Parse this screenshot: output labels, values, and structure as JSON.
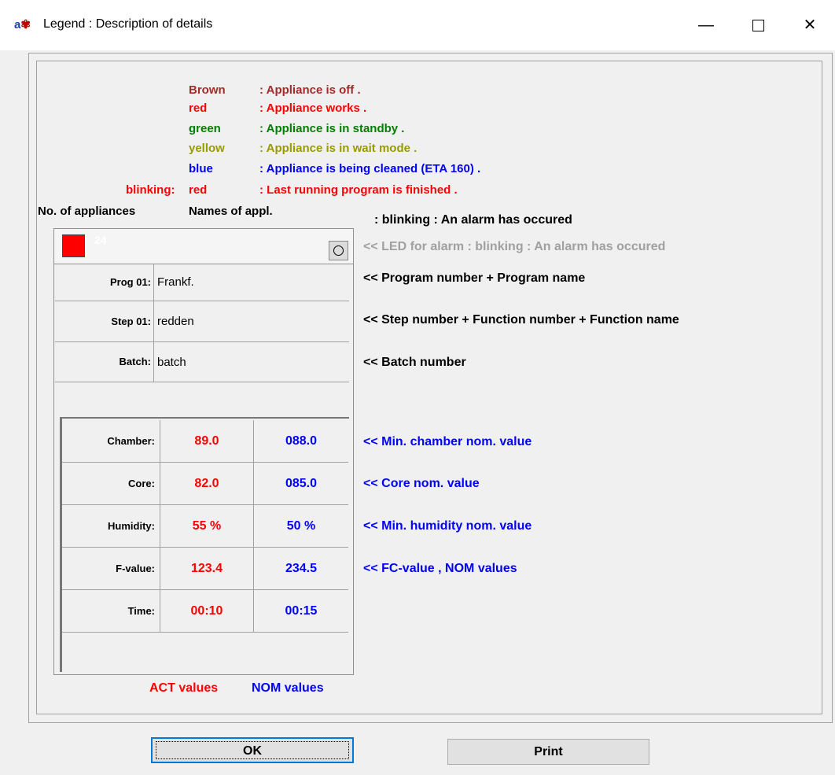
{
  "window": {
    "icon_text": "a",
    "title": "Legend : Description of details",
    "minimize_glyph": "—",
    "close_glyph": "✕"
  },
  "legend": {
    "items": [
      {
        "name": "Brown",
        "desc": ": Appliance is off .",
        "color": "#a52a2a"
      },
      {
        "name": "red",
        "desc": ": Appliance works .",
        "color": "#ff0000"
      },
      {
        "name": "green",
        "desc": ": Appliance is in standby .",
        "color": "#008000"
      },
      {
        "name": "yellow",
        "desc": ": Appliance is in wait mode .",
        "color": "#9a9a00"
      },
      {
        "name": "blue",
        "desc": ": Appliance is being cleaned (ETA 160) .",
        "color": "#0000ff"
      }
    ],
    "blinking_prefix": "blinking:",
    "blinking_name": "red",
    "blinking_desc": ": Last running program is finished .",
    "blinking_color": "#ff0000"
  },
  "headers": {
    "no_of_appliances": "No. of appliances",
    "names_of_appl": "Names of appl.",
    "alarm_note": ": blinking : An alarm has occured"
  },
  "panel": {
    "appliance_number": "24",
    "rows": [
      {
        "label": "Prog 01:",
        "value": "Frankf."
      },
      {
        "label": "Step 01:",
        "value": "redden"
      },
      {
        "label": "Batch:",
        "value": "batch"
      }
    ],
    "grid": [
      {
        "label": "Chamber:",
        "act": "89.0",
        "nom": "088.0"
      },
      {
        "label": "Core:",
        "act": "82.0",
        "nom": "085.0"
      },
      {
        "label": "Humidity:",
        "act": "55 %",
        "nom": "50 %"
      },
      {
        "label": "F-value:",
        "act": "123.4",
        "nom": "234.5"
      },
      {
        "label": "Time:",
        "act": "00:10",
        "nom": "00:15"
      }
    ],
    "act_label": "ACT values",
    "nom_label": "NOM values"
  },
  "notes": {
    "led": "<< LED for alarm : blinking : An alarm has occured",
    "program": "<< Program number + Program name",
    "step": "<< Step number + Function number + Function name",
    "batch": "<< Batch number",
    "chamber": "<< Min. chamber nom. value",
    "core": "<< Core nom. value",
    "humidity": "<< Min. humidity nom. value",
    "fvalue": "<< FC-value , NOM values"
  },
  "buttons": {
    "ok": "OK",
    "print": "Print"
  },
  "colors": {
    "act": "#ff0000",
    "nom": "#0000ff",
    "led_note": "#a0a0a0"
  }
}
